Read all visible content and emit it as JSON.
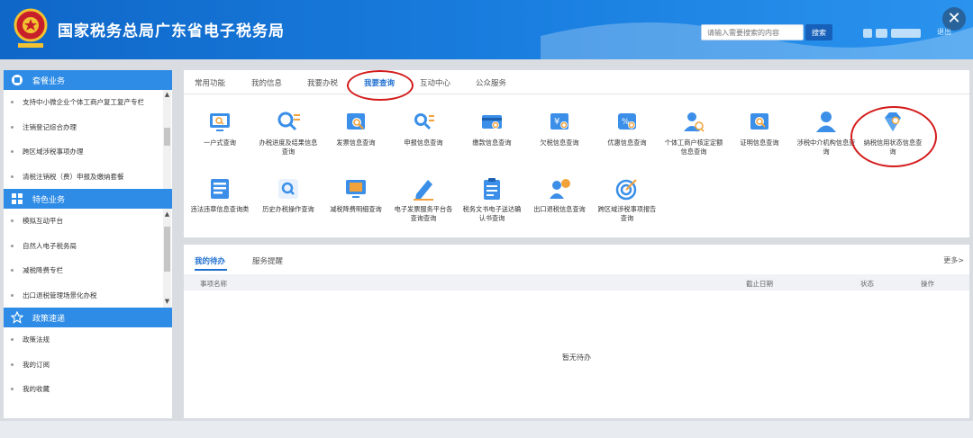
{
  "header": {
    "title": "国家税务总局广东省电子税务局",
    "search_placeholder": "请输入需要搜索的内容",
    "search_button": "搜索",
    "logout": "退出",
    "close": "✕",
    "bg_color": "#1a7fe0"
  },
  "sidebar": {
    "sections": [
      {
        "title": "套餐业务",
        "items": [
          "支持中小微企业个体工商户复工复产专栏",
          "注销登记综合办理",
          "跨区域涉税事项办理",
          "清税注销税（费）申报及缴纳套餐"
        ]
      },
      {
        "title": "特色业务",
        "items": [
          "模拟互动平台",
          "自然人电子税务局",
          "减税降费专栏",
          "出口退税管理场景化办税"
        ]
      },
      {
        "title": "政策速递",
        "items": [
          "政策法规",
          "我的订阅",
          "我的收藏"
        ]
      }
    ]
  },
  "tabs": [
    "常用功能",
    "我的信息",
    "我要办税",
    "我要查询",
    "互动中心",
    "公众服务"
  ],
  "active_tab": "我要查询",
  "functions": [
    {
      "icon": "monitor-search-icon",
      "label": "一户式查询"
    },
    {
      "icon": "magnifier-list-icon",
      "label": "办税进度及结果信息查询"
    },
    {
      "icon": "invoice-search-icon",
      "label": "发票信息查询"
    },
    {
      "icon": "declare-search-icon",
      "label": "申报信息查询"
    },
    {
      "icon": "payment-card-icon",
      "label": "缴款信息查询"
    },
    {
      "icon": "overdue-tax-icon",
      "label": "欠税信息查询"
    },
    {
      "icon": "discount-tag-icon",
      "label": "优惠信息查询"
    },
    {
      "icon": "person-search-icon",
      "label": "个体工商户核定定额信息查询"
    },
    {
      "icon": "certificate-search-icon",
      "label": "证明信息查询"
    },
    {
      "icon": "agency-person-icon",
      "label": "涉税中介机构信息查询"
    },
    {
      "icon": "credit-diamond-icon",
      "label": "纳税信用状态信息查询"
    },
    {
      "icon": "document-lines-icon",
      "label": "违法违章信息查询类"
    },
    {
      "icon": "history-search-icon",
      "label": "历史办税操作查询"
    },
    {
      "icon": "reduction-screen-icon",
      "label": "减税降费明细查询"
    },
    {
      "icon": "pen-icon",
      "label": "电子发票服务平台各查询查询"
    },
    {
      "icon": "clipboard-icon",
      "label": "税务文书电子送达确认书查询"
    },
    {
      "icon": "export-refund-icon",
      "label": "出口退税信息查询"
    },
    {
      "icon": "target-icon",
      "label": "跨区域涉税事项报告查询"
    }
  ],
  "todo": {
    "tabs": [
      "我的待办",
      "服务提醒"
    ],
    "more": "更多>",
    "columns": [
      "事项名称",
      "截止日期",
      "状态",
      "操作"
    ],
    "empty": "暂无待办"
  }
}
